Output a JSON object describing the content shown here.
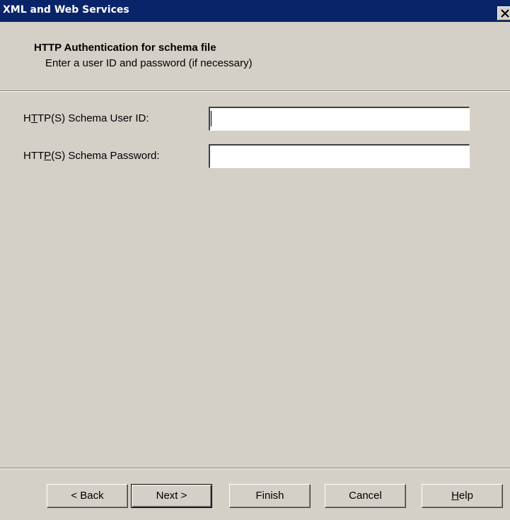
{
  "window": {
    "title": "XML and Web Services",
    "close_icon": "close-icon"
  },
  "header": {
    "title": "HTTP Authentication for schema file",
    "subtitle": "Enter a user ID and password (if necessary)"
  },
  "fields": {
    "user_id": {
      "label_pre": "H",
      "label_accel": "T",
      "label_post": "TP(S) Schema User ID:",
      "value": ""
    },
    "password": {
      "label_pre": "HTT",
      "label_accel": "P",
      "label_post": "(S) Schema Password:",
      "value": ""
    }
  },
  "buttons": {
    "back": "< Back",
    "next": "Next >",
    "finish": "Finish",
    "cancel": "Cancel",
    "help_accel": "H",
    "help_rest": "elp"
  },
  "colors": {
    "titlebar": "#0a246a",
    "dialog_bg": "#d4d0c8"
  }
}
